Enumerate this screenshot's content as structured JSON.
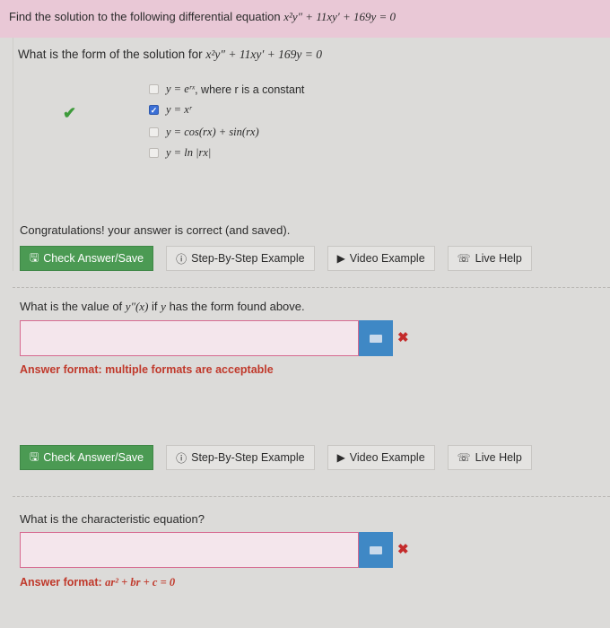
{
  "header": {
    "prompt": "Find the solution to the following differential equation",
    "equation": "x²y″ + 11xy′ + 169y = 0"
  },
  "question1": {
    "prompt": "What is the form of the solution for",
    "equation": "x²y″ + 11xy′ + 169y = 0",
    "options": [
      {
        "math": "y = eʳˣ",
        "suffix": ", where r is a constant",
        "checked": false
      },
      {
        "math": "y = xʳ",
        "suffix": "",
        "checked": true
      },
      {
        "math": "y = cos(rx) + sin(rx)",
        "suffix": "",
        "checked": false
      },
      {
        "math": "y = ln |rx|",
        "suffix": "",
        "checked": false
      }
    ],
    "feedback": "Congratulations! your answer is correct (and saved)."
  },
  "buttons": {
    "check": "Check Answer/Save",
    "step": "Step-By-Step Example",
    "video": "Video Example",
    "help": "Live Help"
  },
  "question2": {
    "prompt_pre": "What is the value of",
    "prompt_math": "y″(x)",
    "prompt_mid": "if",
    "prompt_var": "y",
    "prompt_post": "has the form found above.",
    "input_value": "",
    "format": "Answer format: multiple formats are acceptable"
  },
  "question3": {
    "prompt": "What is the characteristic equation?",
    "input_value": "",
    "format_label": "Answer format:",
    "format_math": "ar² + br + c = 0"
  },
  "colors": {
    "header_bg": "#e9c8d6",
    "primary_button": "#4b9a53",
    "error": "#c42b2b",
    "keyboard_button": "#3f88c5"
  }
}
